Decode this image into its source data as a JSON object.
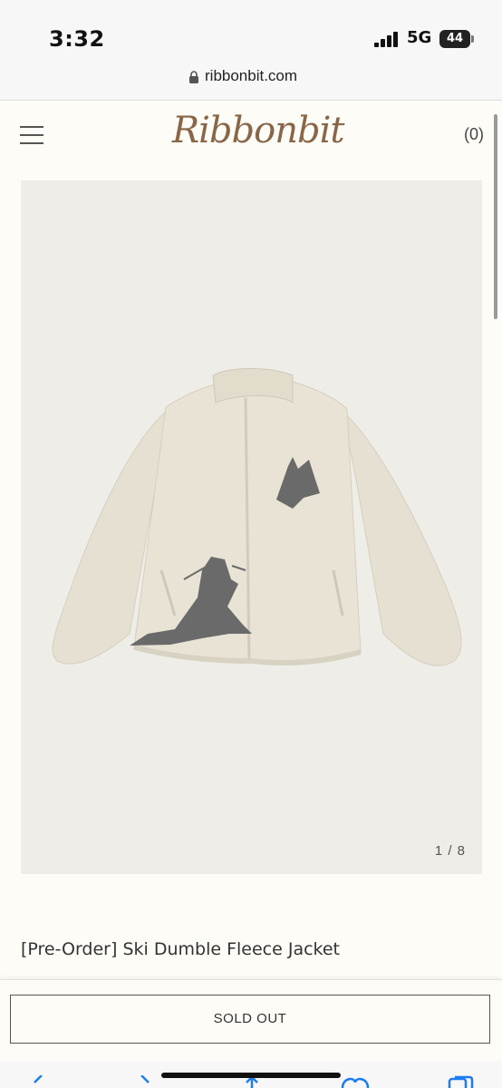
{
  "status_bar": {
    "time": "3:32",
    "network": "5G",
    "battery": "44"
  },
  "browser": {
    "url": "ribbonbit.com"
  },
  "header": {
    "logo": "Ribbonbit",
    "cart": "(0)",
    "menu_icon": "hamburger-menu-icon"
  },
  "product": {
    "image_counter": "1 / 8",
    "title": "[Pre-Order] Ski Dumble Fleece Jacket",
    "button_label": "SOLD OUT"
  },
  "colors": {
    "background": "#fdfcf7",
    "logo": "#8a6648",
    "image_background": "#eeede8",
    "jacket": "#e6e0d2",
    "motif": "#6a6a6a",
    "accent_blue": "#1e7cf2"
  },
  "toolbar": {
    "icons": [
      "back-icon",
      "forward-icon",
      "share-icon",
      "bookmarks-icon",
      "tabs-icon"
    ]
  }
}
